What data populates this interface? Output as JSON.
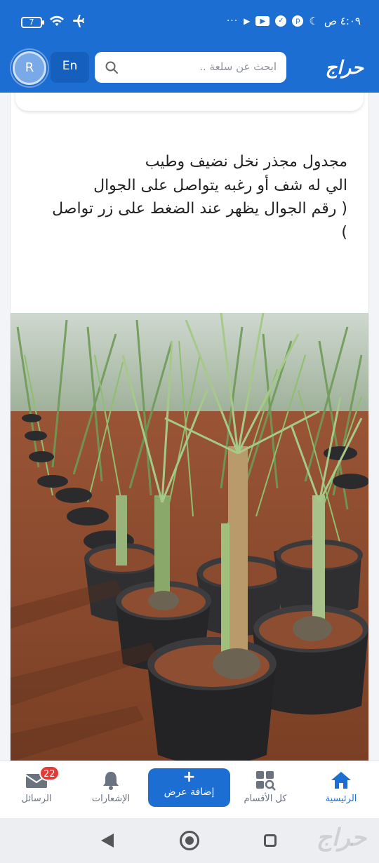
{
  "status_bar": {
    "battery": "7",
    "time": "٤:٠٩ ص",
    "more": "···"
  },
  "header": {
    "avatar_letter": "R",
    "lang_button": "En",
    "search_placeholder": "ابحث عن سلعة ..",
    "logo": "حراج"
  },
  "post": {
    "text": "مجدول مجذر  نخل نضيف وطيب\nالي له شف أو رغبه  يتواصل على الجوال\n( رقم الجوال يظهر عند الضغط على زر تواصل\n)"
  },
  "bottom_nav": {
    "home": "الرئيسية",
    "categories": "كل الأقسام",
    "add_plus": "+",
    "add_offer": "إضافة عرض",
    "notifications": "الإشعارات",
    "messages": "الرسائل",
    "messages_badge": "22"
  },
  "system_nav": {
    "watermark": "حراج"
  },
  "colors": {
    "brand_blue": "#1d6ed2",
    "badge_red": "#e53935"
  }
}
